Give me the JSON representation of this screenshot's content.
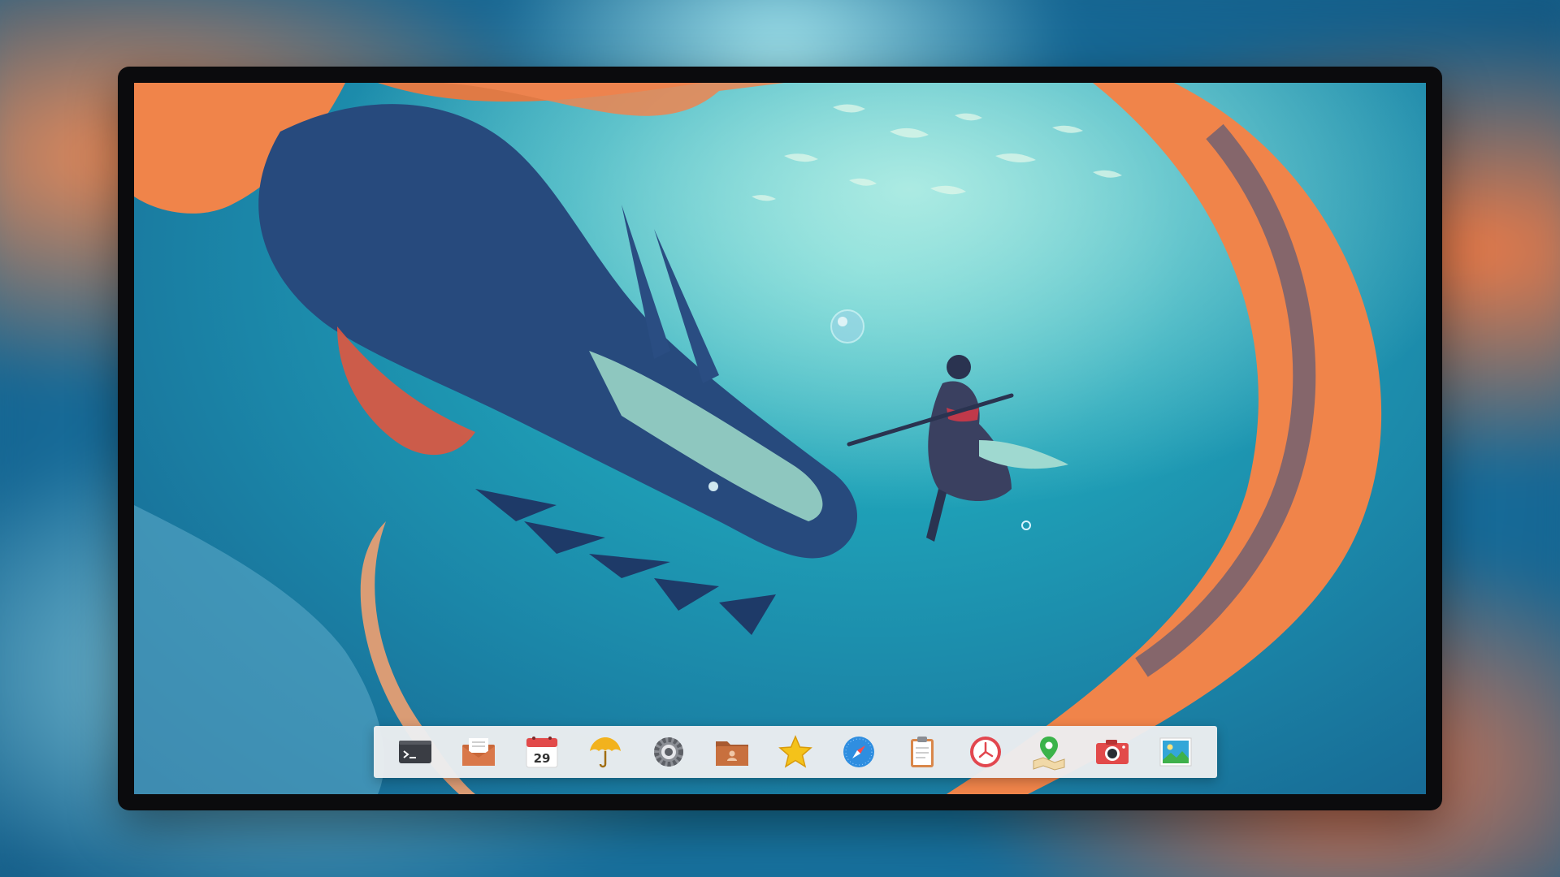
{
  "dock": {
    "items": [
      {
        "id": "terminal",
        "icon": "terminal-icon",
        "color": "#3a3d44"
      },
      {
        "id": "mail",
        "icon": "mail-envelope-icon",
        "color": "#c9683a"
      },
      {
        "id": "calendar",
        "icon": "calendar-icon",
        "color": "#e24a4a",
        "day": "29"
      },
      {
        "id": "weather",
        "icon": "umbrella-icon",
        "color": "#f2b21d"
      },
      {
        "id": "settings",
        "icon": "gear-icon",
        "color": "#6a6d73"
      },
      {
        "id": "files",
        "icon": "folder-icon",
        "color": "#c8703e"
      },
      {
        "id": "favorites",
        "icon": "star-icon",
        "color": "#f4c21a"
      },
      {
        "id": "browser",
        "icon": "compass-icon",
        "color": "#2f8ee0"
      },
      {
        "id": "notes",
        "icon": "clipboard-icon",
        "color": "#d9874a"
      },
      {
        "id": "clock",
        "icon": "clock-icon",
        "color": "#e2474f"
      },
      {
        "id": "maps",
        "icon": "map-pin-icon",
        "color": "#3bb34a"
      },
      {
        "id": "camera",
        "icon": "camera-icon",
        "color": "#e24a4a"
      },
      {
        "id": "photos",
        "icon": "photos-icon",
        "color": "#33a6d8"
      }
    ]
  },
  "wallpaper": {
    "subject": "dragon-and-swimmer-wallpaper",
    "accent": "#f0844a",
    "water": "#1b8fb0"
  }
}
